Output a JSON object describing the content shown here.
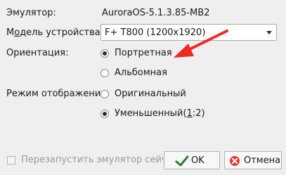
{
  "dialog": {
    "emulator_label": "Эмулятор:",
    "emulator_value": "AuroraOS-5.1.3.85-MB2",
    "device_model_label_pre": "М",
    "device_model_label_u": "о",
    "device_model_label_post": "дель устройства:",
    "device_model_value": "F+ T800 (1200x1920)",
    "orientation_label": "Ориентация:",
    "orientation_options": [
      {
        "label": "Портретная",
        "checked": true
      },
      {
        "label": "Альбомная",
        "checked": false
      }
    ],
    "display_mode_label": "Режим отображения:",
    "display_mode_options": [
      {
        "label": "Оригинальный",
        "checked": false
      },
      {
        "label_pre": "Уменьшенный(",
        "label_u": "1",
        "label_post": ":2)",
        "checked": true
      }
    ],
    "restart_checkbox_label": "Перезапустить эмулятор сейчас",
    "restart_checked": false
  },
  "buttons": {
    "ok_label": "OK",
    "cancel_label": "Отмена"
  },
  "colors": {
    "annotation_arrow": "#ee2a24",
    "ok_check": "#2e7d32",
    "cancel_cross": "#e53935",
    "disabled_text": "#9a9a9a"
  },
  "icons": {
    "combo_arrow": "chevron-down-icon",
    "ok_icon": "checkmark-icon",
    "cancel_icon": "cancel-icon",
    "annotation": "red-arrow-annotation"
  }
}
